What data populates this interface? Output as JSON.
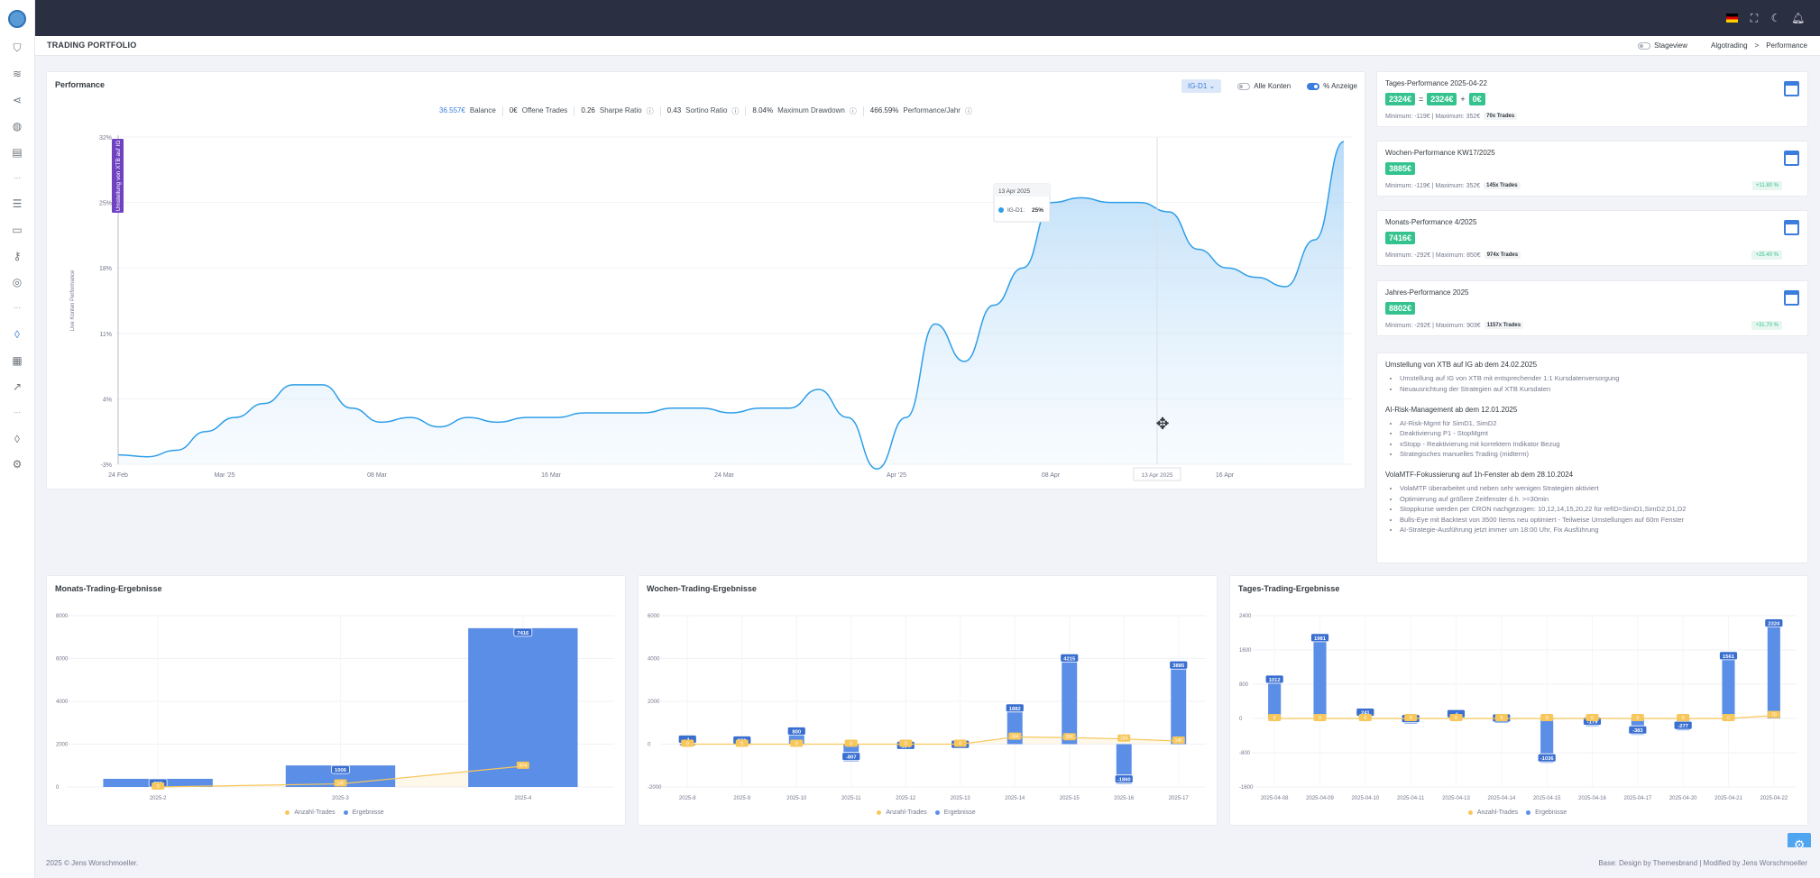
{
  "header": {
    "page_title": "TRADING PORTFOLIO",
    "stageview_label": "Stageview",
    "breadcrumb": [
      "Algotrading",
      ">",
      "Performance"
    ]
  },
  "sidebar": {
    "icons": [
      "shield-icon",
      "layers-icon",
      "share-icon",
      "globe-icon",
      "building-icon",
      "dots-icon",
      "sliders-icon",
      "folder-icon",
      "key-icon",
      "location-icon",
      "dots-icon",
      "drop-icon",
      "report-icon",
      "chart-icon",
      "dots-icon",
      "drop-icon",
      "settings-icon"
    ]
  },
  "performance": {
    "title": "Performance",
    "select_value": "IG-D1",
    "all_accounts_label": "Alle Konten",
    "pct_label": "% Anzeige",
    "stats": [
      {
        "value": "36.557€",
        "label": "Balance",
        "blue": true,
        "info": false
      },
      {
        "value": "0€",
        "label": "Offene Trades",
        "blue": false,
        "info": false
      },
      {
        "value": "0.26",
        "label": "Sharpe Ratio",
        "blue": false,
        "info": true
      },
      {
        "value": "0.43",
        "label": "Sortino Ratio",
        "blue": false,
        "info": true
      },
      {
        "value": "8.04%",
        "label": "Maximum Drawdown",
        "blue": false,
        "info": true
      },
      {
        "value": "466.59%",
        "label": "Performance/Jahr",
        "blue": false,
        "info": true
      }
    ],
    "annotation": "Umstellung von XTB auf IG",
    "tooltip_date": "13 Apr 2025",
    "tooltip_series": "IG-D1:",
    "tooltip_value": "25%",
    "crosshair_label": "13 Apr 2025"
  },
  "chart_data": [
    {
      "type": "area",
      "ylabel": "Live Konten Performance",
      "y_ticks": [
        "32%",
        "25%",
        "18%",
        "11%",
        "4%",
        "-3%"
      ],
      "x_ticks": [
        "24 Feb",
        "Mar '25",
        "08 Mar",
        "16 Mar",
        "24 Mar",
        "Apr '25",
        "08 Apr",
        "13 Apr 2025",
        "16 Apr"
      ],
      "ylim": [
        -3,
        32
      ],
      "series": [
        {
          "name": "IG-D1",
          "values": [
            -2,
            -2.2,
            -1.5,
            0.5,
            2,
            3.5,
            5.5,
            5.5,
            3,
            1.5,
            2,
            1,
            2,
            1.5,
            2,
            2,
            2.5,
            2.5,
            2.5,
            3,
            3,
            2.5,
            3,
            3,
            5,
            2,
            -3.5,
            2,
            12,
            8,
            14,
            18,
            25,
            25.5,
            25,
            25,
            24,
            20,
            18,
            17,
            16,
            21,
            31.5
          ]
        }
      ]
    },
    {
      "type": "bar",
      "title": "Monats-Trading-Ergebnisse",
      "categories": [
        "2025-2",
        "2025-3",
        "2025-4"
      ],
      "ylim": [
        0,
        8000
      ],
      "y_ticks": [
        "8000",
        "6000",
        "4000",
        "2000",
        "0"
      ],
      "series": [
        {
          "name": "Ergebnisse",
          "values": [
            380,
            1006,
            7416
          ]
        },
        {
          "name": "Anzahl-Trades",
          "values": [
            0,
            145,
            974
          ]
        }
      ]
    },
    {
      "type": "bar",
      "title": "Wochen-Trading-Ergebnisse",
      "categories": [
        "2025-8",
        "2025-9",
        "2025-10",
        "2025-11",
        "2025-12",
        "2025-13",
        "2025-14",
        "2025-15",
        "2025-16",
        "2025-17"
      ],
      "ylim": [
        -2000,
        6000
      ],
      "y_ticks": [
        "6000",
        "4000",
        "2000",
        "0",
        "-2000"
      ],
      "series": [
        {
          "name": "Ergebnisse",
          "values": [
            -1,
            379,
            800,
            -807,
            134,
            183,
            1882,
            4215,
            -1860,
            3885
          ]
        },
        {
          "name": "Anzahl-Trades",
          "values": [
            0,
            0,
            0,
            0,
            0,
            0,
            334,
            306,
            244,
            145
          ]
        }
      ]
    },
    {
      "type": "bar",
      "title": "Tages-Trading-Ergebnisse",
      "categories": [
        "2025-04-08",
        "2025-04-09",
        "2025-04-10",
        "2025-04-11",
        "2025-04-13",
        "2025-04-14",
        "2025-04-15",
        "2025-04-16",
        "2025-04-17",
        "2025-04-20",
        "2025-04-21",
        "2025-04-22"
      ],
      "ylim": [
        -1600,
        2400
      ],
      "y_ticks": [
        "2400",
        "1600",
        "800",
        "0",
        "-800",
        "-1600"
      ],
      "series": [
        {
          "name": "Ergebnisse",
          "values": [
            1012,
            1981,
            241,
            -119,
            -6,
            -105,
            -1036,
            -179,
            -383,
            -277,
            1561,
            2324
          ]
        },
        {
          "name": "Anzahl-Trades",
          "values": [
            0,
            0,
            0,
            0,
            0,
            0,
            0,
            0,
            0,
            0,
            0,
            70
          ]
        }
      ]
    }
  ],
  "legend": {
    "trades": "Anzahl-Trades",
    "results": "Ergebnisse"
  },
  "perf_cards": [
    {
      "title": "Tages-Performance 2025-04-22",
      "badges": [
        "2324€",
        "=",
        "2324€",
        "+",
        "0€"
      ],
      "min": "Minimum: -119€ | Maximum: 352€",
      "trades": "70x Trades",
      "pct": ""
    },
    {
      "title": "Wochen-Performance KW17/2025",
      "badges": [
        "3885€"
      ],
      "min": "Minimum: -119€ | Maximum: 352€",
      "trades": "145x Trades",
      "pct": "+11.80 %"
    },
    {
      "title": "Monats-Performance 4/2025",
      "badges": [
        "7416€"
      ],
      "min": "Minimum: -292€ | Maximum: 850€",
      "trades": "974x Trades",
      "pct": "+25.40 %"
    },
    {
      "title": "Jahres-Performance 2025",
      "badges": [
        "8802€"
      ],
      "min": "Minimum: -292€ | Maximum: 903€",
      "trades": "1157x Trades",
      "pct": "+31.70 %"
    }
  ],
  "notes": [
    {
      "title": "Umstellung von XTB auf IG ab dem 24.02.2025",
      "items": [
        "Umstellung auf IG von XTB mit entsprechender 1:1 Kursdatenversorgung",
        "Neuausrichtung der Strategien auf XTB Kursdaten"
      ]
    },
    {
      "title": "AI-Risk-Management ab dem 12.01.2025",
      "items": [
        "AI-Risk-Mgmt für SimD1, SimD2",
        "Deaktivierung P1 - StopMgmt",
        "xStopp - Reaktivierung mit korrektem Indikator Bezug",
        "Strategisches manuelles Trading (midterm)"
      ]
    },
    {
      "title": "VolaMTF-Fokussierung auf 1h-Fenster ab dem 28.10.2024",
      "items": [
        "VolaMTF überarbeitet und neben sehr wenigen Strategien aktiviert",
        "Optimierung auf größere Zeitfenster d.h. >=30min",
        "Stoppkurse werden per CRON nachgezogen: 10,12,14,15,20,22 für refID=SimD1,SimD2,D1,D2",
        "Bulls-Eye mit Backtest von 3500 Items neu optimiert - Teilweise Umstellungen auf 60m Fenster",
        "AI-Strategie-Ausführung jetzt immer um 18:00 Uhr, Fix Ausführung"
      ]
    }
  ],
  "footer": {
    "left": "2025 © Jens Worschmoeller.",
    "right": "Base: Design by Themesbrand | Modified by Jens Worschmoeller"
  },
  "colors": {
    "accent": "#3b7ddd",
    "bar": "#5b8ee6",
    "line": "#f7c75c",
    "success": "#34c38f",
    "topbar": "#2a3042"
  }
}
